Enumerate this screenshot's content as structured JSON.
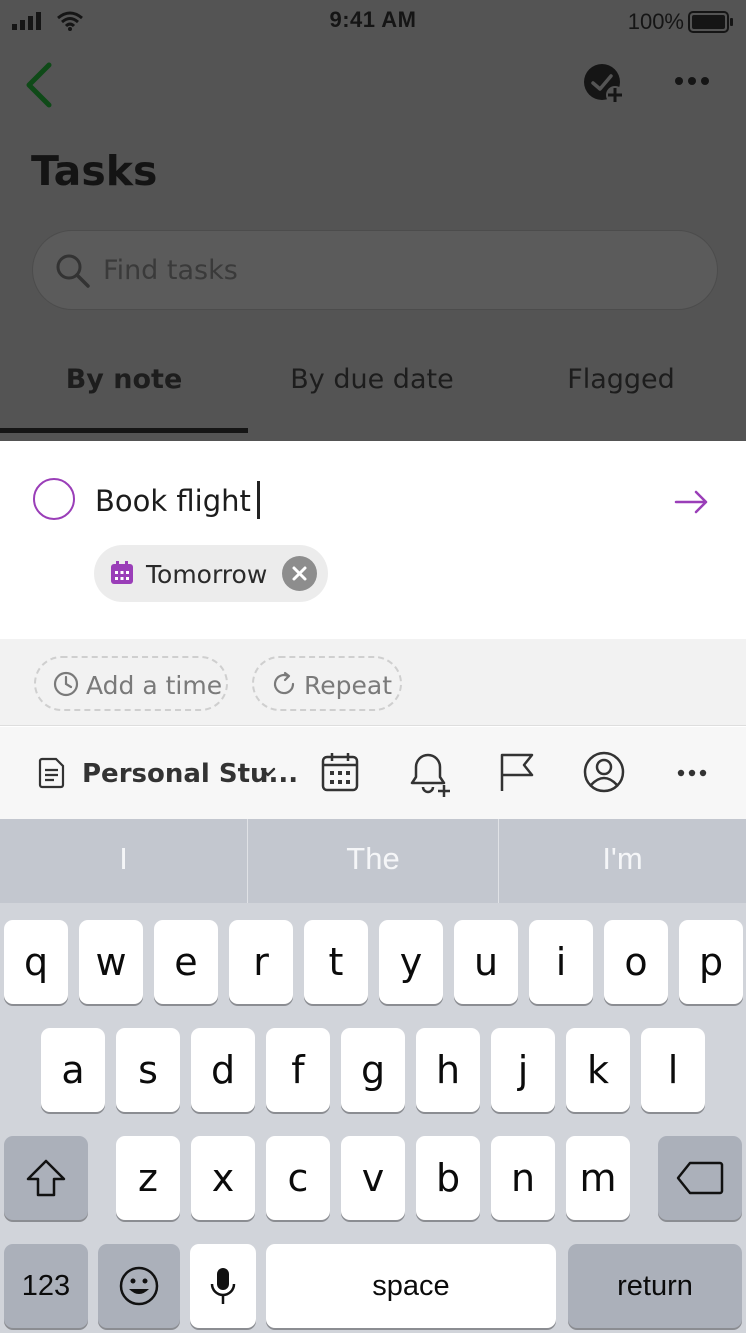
{
  "status_bar": {
    "time": "9:41 AM",
    "battery_percent": "100%"
  },
  "header": {
    "title": "Tasks",
    "back_icon": "chevron-left-icon",
    "new_task_icon": "check-circle-add-icon",
    "more_icon": "more-horizontal-icon"
  },
  "search": {
    "placeholder": "Find tasks"
  },
  "tabs": [
    {
      "label": "By note",
      "active": true
    },
    {
      "label": "By due date",
      "active": false
    },
    {
      "label": "Flagged",
      "active": false
    }
  ],
  "task_input": {
    "value": "Book flight",
    "due_chip_label": "Tomorrow"
  },
  "options": {
    "add_time_label": "Add a time",
    "repeat_label": "Repeat"
  },
  "toolbar": {
    "note_label": "Personal Stu..."
  },
  "keyboard": {
    "suggestions": [
      "I",
      "The",
      "I'm"
    ],
    "row1": [
      "q",
      "w",
      "e",
      "r",
      "t",
      "y",
      "u",
      "i",
      "o",
      "p"
    ],
    "row2": [
      "a",
      "s",
      "d",
      "f",
      "g",
      "h",
      "j",
      "k",
      "l"
    ],
    "row3": [
      "z",
      "x",
      "c",
      "v",
      "b",
      "n",
      "m"
    ],
    "numbers_label": "123",
    "space_label": "space",
    "return_label": "return"
  },
  "colors": {
    "accent": "#9a3eb8",
    "back_arrow": "#0f5a1c"
  }
}
